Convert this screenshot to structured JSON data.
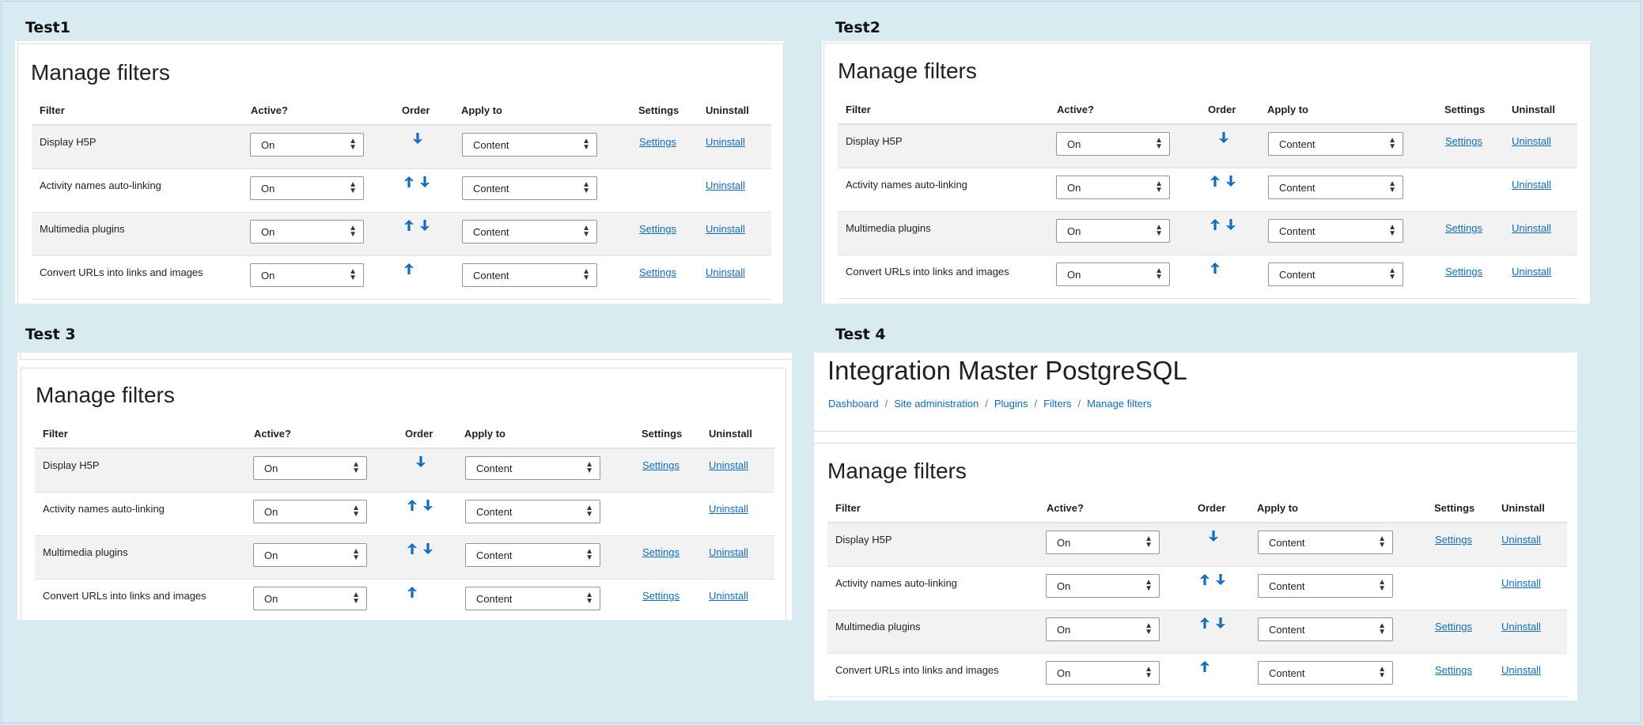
{
  "sections": [
    {
      "label": "Test1"
    },
    {
      "label": "Test2"
    },
    {
      "label": "Test 3"
    },
    {
      "label": "Test 4"
    }
  ],
  "heading": "Manage filters",
  "site_title": "Integration Master PostgreSQL",
  "breadcrumb": [
    "Dashboard",
    "Site administration",
    "Plugins",
    "Filters",
    "Manage filters"
  ],
  "columns": {
    "filter": "Filter",
    "active": "Active?",
    "order": "Order",
    "apply": "Apply to",
    "settings": "Settings",
    "uninstall": "Uninstall"
  },
  "rows": [
    {
      "name": "Display H5P",
      "active": "On",
      "apply": "Content",
      "settings": "Settings",
      "uninstall": "Uninstall",
      "up": false,
      "down": true
    },
    {
      "name": "Activity names auto-linking",
      "active": "On",
      "apply": "Content",
      "settings": "",
      "uninstall": "Uninstall",
      "up": true,
      "down": true
    },
    {
      "name": "Multimedia plugins",
      "active": "On",
      "apply": "Content",
      "settings": "Settings",
      "uninstall": "Uninstall",
      "up": true,
      "down": true
    },
    {
      "name": "Convert URLs into links and images",
      "active": "On",
      "apply": "Content",
      "settings": "Settings",
      "uninstall": "Uninstall",
      "up": true,
      "down": false
    }
  ],
  "colors": {
    "link": "#0f6cbf",
    "background": "#d8ebf0",
    "row_alt": "#f2f2f2"
  }
}
